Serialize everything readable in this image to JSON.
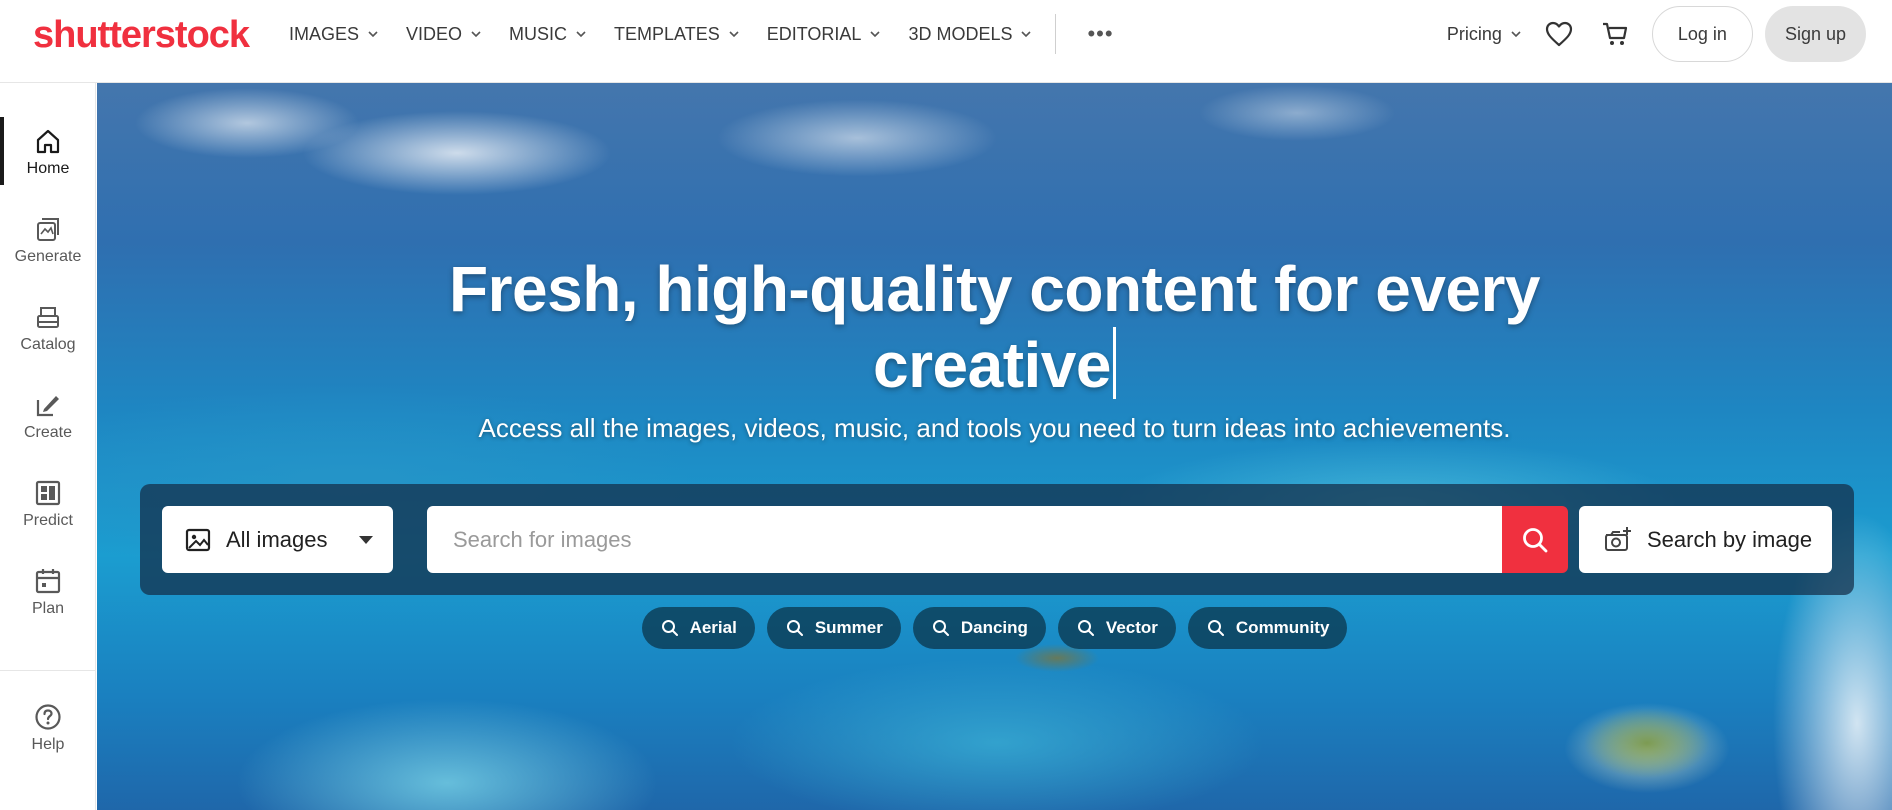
{
  "brand": {
    "logo_text": "shutterstock",
    "accent": "#f0303f"
  },
  "nav": {
    "items": [
      {
        "label": "IMAGES"
      },
      {
        "label": "VIDEO"
      },
      {
        "label": "MUSIC"
      },
      {
        "label": "TEMPLATES"
      },
      {
        "label": "EDITORIAL"
      },
      {
        "label": "3D MODELS"
      }
    ],
    "more_label": "•••",
    "pricing_label": "Pricing",
    "login_label": "Log in",
    "signup_label": "Sign up"
  },
  "sidebar": {
    "items": [
      {
        "label": "Home",
        "icon": "home-icon",
        "active": true
      },
      {
        "label": "Generate",
        "icon": "generate-icon"
      },
      {
        "label": "Catalog",
        "icon": "catalog-icon"
      },
      {
        "label": "Create",
        "icon": "create-icon"
      },
      {
        "label": "Predict",
        "icon": "predict-icon"
      },
      {
        "label": "Plan",
        "icon": "plan-icon"
      }
    ],
    "help_label": "Help"
  },
  "hero": {
    "title_line1": "Fresh, high-quality content for every",
    "title_line2": "creative",
    "subtitle": "Access all the images, videos, music, and tools you need to turn ideas into achievements.",
    "type_select_value": "All images",
    "search_placeholder": "Search for images",
    "search_value": "",
    "search_by_image_label": "Search by image",
    "chips": [
      "Aerial",
      "Summer",
      "Dancing",
      "Vector",
      "Community"
    ]
  }
}
